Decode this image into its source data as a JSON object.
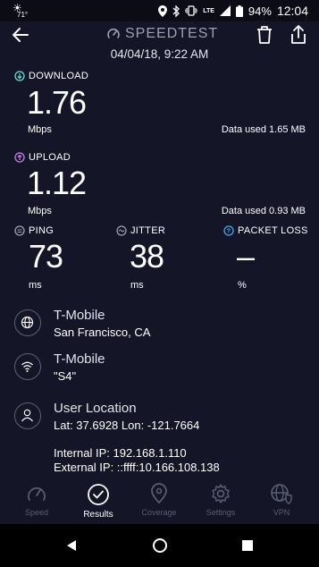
{
  "status_bar": {
    "temperature": "71°",
    "battery_percent": "94%",
    "network": "LTE",
    "time": "12:04"
  },
  "header": {
    "brand": "SPEEDTEST",
    "timestamp": "04/04/18, 9:22 AM"
  },
  "download": {
    "label": "DOWNLOAD",
    "value": "1.76",
    "unit": "Mbps",
    "data_used": "Data used 1.65 MB",
    "icon_color": "#5ce1d6"
  },
  "upload": {
    "label": "UPLOAD",
    "value": "1.12",
    "unit": "Mbps",
    "data_used": "Data used 0.93 MB",
    "icon_color": "#c77dea"
  },
  "ping": {
    "label": "PING",
    "value": "73",
    "unit": "ms"
  },
  "jitter": {
    "label": "JITTER",
    "value": "38",
    "unit": "ms"
  },
  "packet_loss": {
    "label": "PACKET LOSS",
    "value": "–",
    "unit": "%",
    "icon_color": "#3ea9f5"
  },
  "provider": {
    "name": "T-Mobile",
    "location": "San Francisco, CA"
  },
  "wifi": {
    "name": "T-Mobile",
    "ssid": "\"S4\""
  },
  "user_location": {
    "title": "User Location",
    "coords": "Lat: 37.6928 Lon: -121.7664"
  },
  "ip": {
    "internal": "Internal IP: 192.168.1.110",
    "external": "External IP: ::ffff:10.166.108.138"
  },
  "nav": {
    "items": [
      {
        "label": "Speed",
        "icon": "gauge-icon"
      },
      {
        "label": "Results",
        "icon": "check-circle-icon",
        "active": true
      },
      {
        "label": "Coverage",
        "icon": "map-pin-icon"
      },
      {
        "label": "Settings",
        "icon": "gear-icon"
      },
      {
        "label": "VPN",
        "icon": "globe-shield-icon"
      }
    ]
  }
}
